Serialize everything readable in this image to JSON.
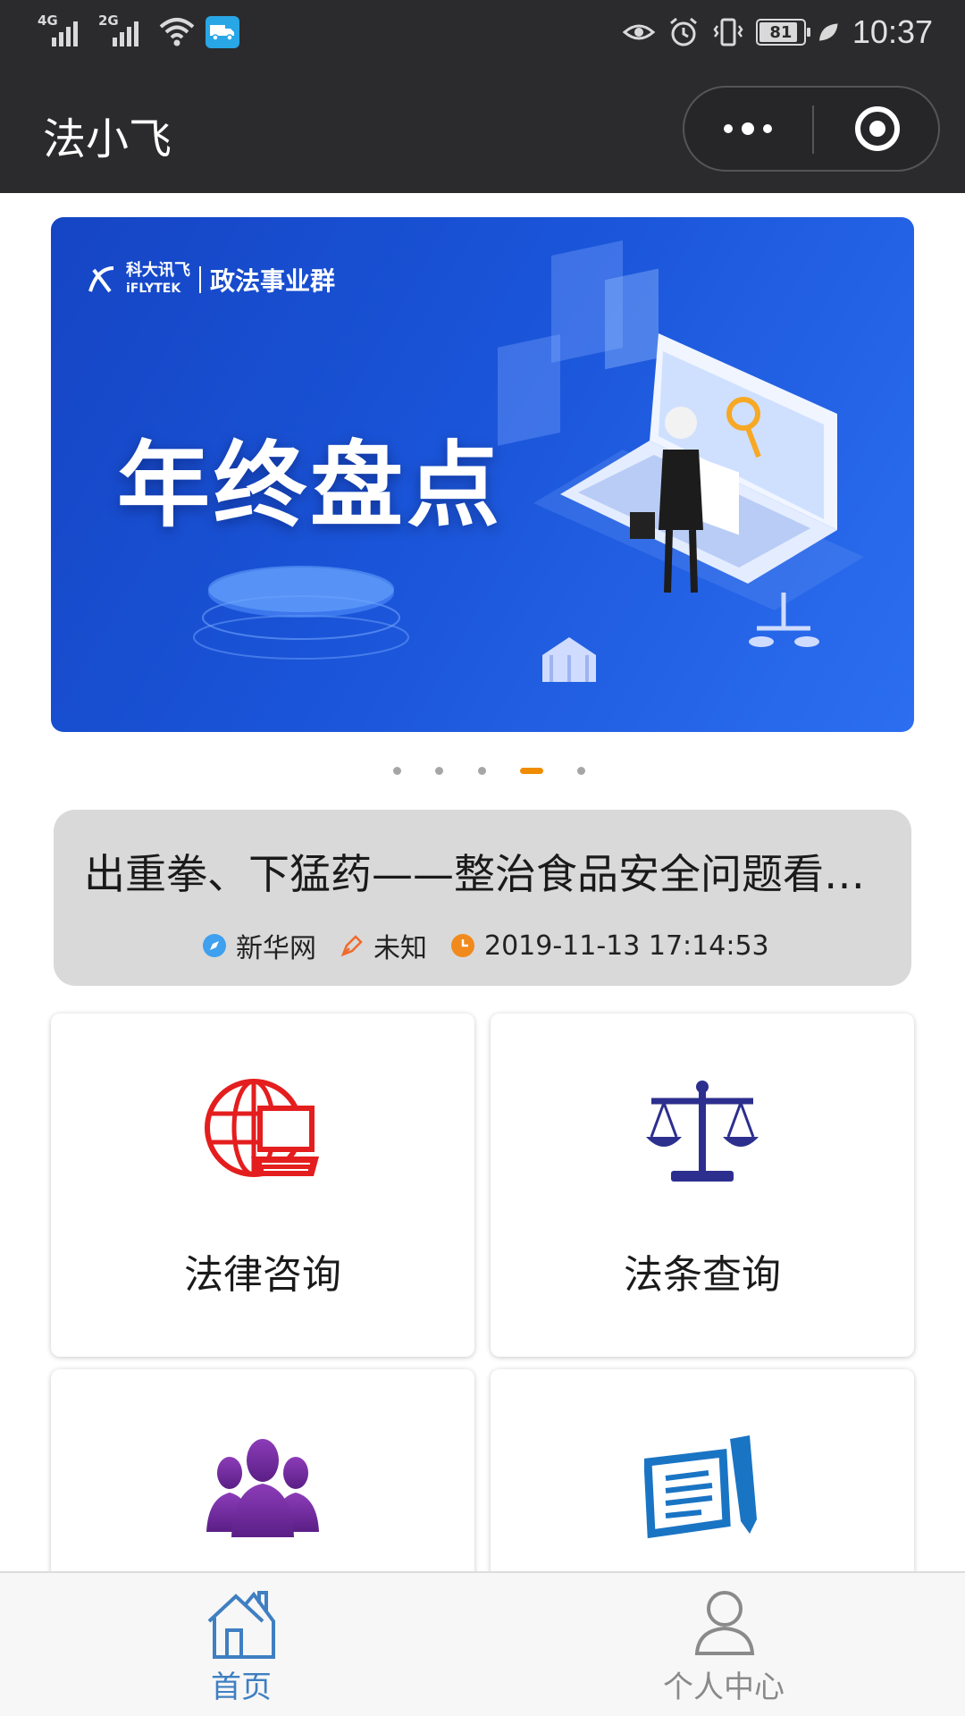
{
  "status_bar": {
    "network_1": "4G",
    "network_2": "2G",
    "battery": "81",
    "time": "10:37",
    "icons": [
      "signal-icon",
      "wifi-icon",
      "truck-app-icon",
      "eye-icon",
      "alarm-icon",
      "vibrate-icon",
      "battery-icon",
      "leaf-icon"
    ]
  },
  "nav": {
    "title": "法小飞"
  },
  "banner": {
    "logo_brand": "科大讯飞",
    "logo_brand_en": "iFLYTEK",
    "logo_group": "政法事业群",
    "headline": "年终盘点",
    "slides_total": 5,
    "active_slide": 4
  },
  "colors": {
    "status_bg": "#2b2b2d",
    "accent_dot": "#f08c00",
    "tab_active": "#3f7fc2",
    "tab_inactive": "#8a8a8a"
  },
  "news": {
    "title": "出重拳、下猛药——整治食品安全问题看…",
    "source": "新华网",
    "author": "未知",
    "datetime": "2019-11-13 17:14:53"
  },
  "tiles": [
    {
      "label": "法律咨询",
      "icon": "globe-laptop-icon"
    },
    {
      "label": "法条查询",
      "icon": "scales-icon"
    },
    {
      "label": "",
      "icon": "people-group-icon"
    },
    {
      "label": "",
      "icon": "document-pen-icon"
    }
  ],
  "tabbar": {
    "home": "首页",
    "profile": "个人中心"
  }
}
